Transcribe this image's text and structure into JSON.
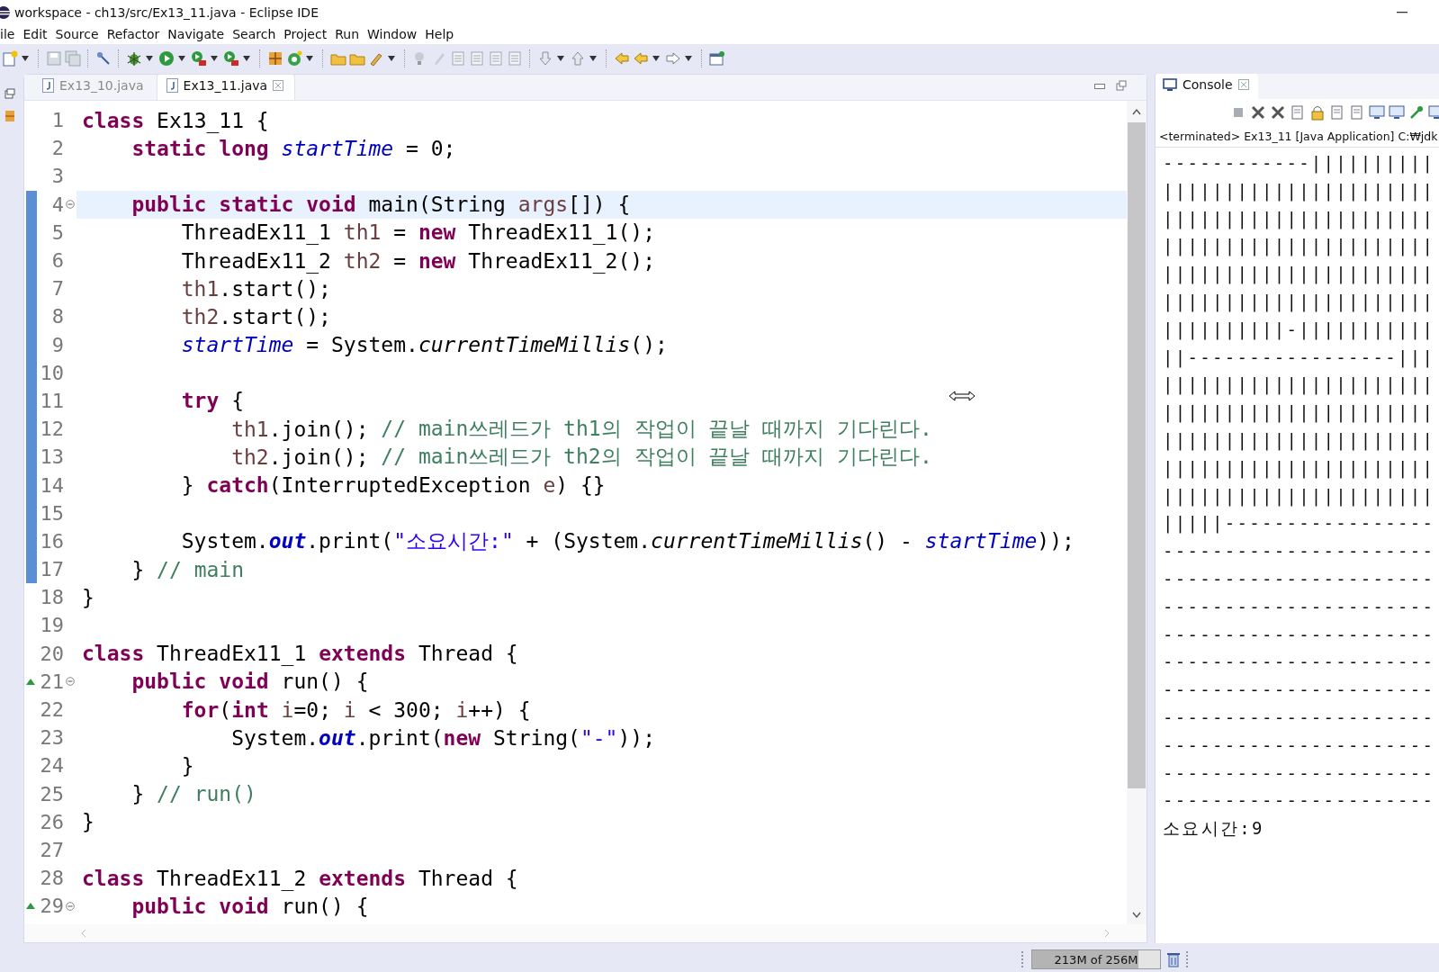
{
  "window": {
    "title": "workspace - ch13/src/Ex13_11.java - Eclipse IDE"
  },
  "menu": [
    "ile",
    "Edit",
    "Source",
    "Refactor",
    "Navigate",
    "Search",
    "Project",
    "Run",
    "Window",
    "Help"
  ],
  "editor": {
    "tabs": [
      {
        "label": "Ex13_10.java",
        "selected": false
      },
      {
        "label": "Ex13_11.java",
        "selected": true
      }
    ],
    "lines": [
      {
        "number": "1",
        "current": false,
        "in_range": false,
        "fold": false,
        "override": false,
        "tokens": [
          {
            "text": "class",
            "kind": "keyword"
          },
          {
            "text": " Ex13_11 {",
            "kind": "plain"
          }
        ]
      },
      {
        "number": "2",
        "current": false,
        "in_range": false,
        "fold": false,
        "override": false,
        "tokens": [
          {
            "text": "    static",
            "kind": "keyword"
          },
          {
            "text": " long",
            "kind": "keyword"
          },
          {
            "text": " startTime",
            "kind": "field"
          },
          {
            "text": " = 0;",
            "kind": "plain"
          }
        ]
      },
      {
        "number": "3",
        "current": false,
        "in_range": false,
        "fold": false,
        "override": false
      },
      {
        "number": "4",
        "current": true,
        "in_range": true,
        "fold": true,
        "override": false,
        "tokens": [
          {
            "text": "    public",
            "kind": "keyword"
          },
          {
            "text": " static",
            "kind": "keyword"
          },
          {
            "text": " void",
            "kind": "keyword"
          },
          {
            "text": " main(String ",
            "kind": "plain"
          },
          {
            "text": "args",
            "kind": "local"
          },
          {
            "text": "[]) {",
            "kind": "plain"
          }
        ]
      },
      {
        "number": "5",
        "current": false,
        "in_range": true,
        "fold": false,
        "override": false,
        "tokens": [
          {
            "text": "        ThreadEx11_1 ",
            "kind": "plain"
          },
          {
            "text": "th1",
            "kind": "local"
          },
          {
            "text": " = ",
            "kind": "plain"
          },
          {
            "text": "new",
            "kind": "keyword"
          },
          {
            "text": " ThreadEx11_1();",
            "kind": "plain"
          }
        ]
      },
      {
        "number": "6",
        "current": false,
        "in_range": true,
        "fold": false,
        "override": false,
        "tokens": [
          {
            "text": "        ThreadEx11_2 ",
            "kind": "plain"
          },
          {
            "text": "th2",
            "kind": "local"
          },
          {
            "text": " = ",
            "kind": "plain"
          },
          {
            "text": "new",
            "kind": "keyword"
          },
          {
            "text": " ThreadEx11_2();",
            "kind": "plain"
          }
        ]
      },
      {
        "number": "7",
        "current": false,
        "in_range": true,
        "fold": false,
        "override": false,
        "tokens": [
          {
            "text": "        th1",
            "kind": "local"
          },
          {
            "text": ".start();",
            "kind": "plain"
          }
        ]
      },
      {
        "number": "8",
        "current": false,
        "in_range": true,
        "fold": false,
        "override": false,
        "tokens": [
          {
            "text": "        th2",
            "kind": "local"
          },
          {
            "text": ".start();",
            "kind": "plain"
          }
        ]
      },
      {
        "number": "9",
        "current": false,
        "in_range": true,
        "fold": false,
        "override": false,
        "tokens": [
          {
            "text": "        startTime",
            "kind": "field"
          },
          {
            "text": " = System.",
            "kind": "plain"
          },
          {
            "text": "currentTimeMillis",
            "kind": "static-method"
          },
          {
            "text": "();",
            "kind": "plain"
          }
        ]
      },
      {
        "number": "10",
        "current": false,
        "in_range": true,
        "fold": false,
        "override": false
      },
      {
        "number": "11",
        "current": false,
        "in_range": true,
        "fold": false,
        "override": false,
        "tokens": [
          {
            "text": "        try",
            "kind": "keyword"
          },
          {
            "text": " {",
            "kind": "plain"
          }
        ]
      },
      {
        "number": "12",
        "current": false,
        "in_range": true,
        "fold": false,
        "override": false,
        "tokens": [
          {
            "text": "            th1",
            "kind": "local"
          },
          {
            "text": ".join(); ",
            "kind": "plain"
          },
          {
            "text": "// main쓰레드가 th1의 작업이 끝날 때까지 기다린다.",
            "kind": "comment"
          }
        ]
      },
      {
        "number": "13",
        "current": false,
        "in_range": true,
        "fold": false,
        "override": false,
        "tokens": [
          {
            "text": "            th2",
            "kind": "local"
          },
          {
            "text": ".join(); ",
            "kind": "plain"
          },
          {
            "text": "// main쓰레드가 th2의 작업이 끝날 때까지 기다린다.",
            "kind": "comment"
          }
        ]
      },
      {
        "number": "14",
        "current": false,
        "in_range": true,
        "fold": false,
        "override": false,
        "tokens": [
          {
            "text": "        } ",
            "kind": "plain"
          },
          {
            "text": "catch",
            "kind": "keyword"
          },
          {
            "text": "(InterruptedException ",
            "kind": "plain"
          },
          {
            "text": "e",
            "kind": "local"
          },
          {
            "text": ") {}",
            "kind": "plain"
          }
        ]
      },
      {
        "number": "15",
        "current": false,
        "in_range": true,
        "fold": false,
        "override": false
      },
      {
        "number": "16",
        "current": false,
        "in_range": true,
        "fold": false,
        "override": false,
        "tokens": [
          {
            "text": "        System.",
            "kind": "plain"
          },
          {
            "text": "out",
            "kind": "static-field"
          },
          {
            "text": ".print(",
            "kind": "plain"
          },
          {
            "text": "\"소요시간:\"",
            "kind": "string"
          },
          {
            "text": " + (System.",
            "kind": "plain"
          },
          {
            "text": "currentTimeMillis",
            "kind": "static-method"
          },
          {
            "text": "() - ",
            "kind": "plain"
          },
          {
            "text": "startTime",
            "kind": "field"
          },
          {
            "text": "));",
            "kind": "plain"
          }
        ]
      },
      {
        "number": "17",
        "current": false,
        "in_range": true,
        "fold": false,
        "override": false,
        "tokens": [
          {
            "text": "    } ",
            "kind": "plain"
          },
          {
            "text": "// main",
            "kind": "comment"
          }
        ]
      },
      {
        "number": "18",
        "current": false,
        "in_range": false,
        "fold": false,
        "override": false,
        "tokens": [
          {
            "text": "}",
            "kind": "plain"
          }
        ]
      },
      {
        "number": "19",
        "current": false,
        "in_range": false,
        "fold": false,
        "override": false
      },
      {
        "number": "20",
        "current": false,
        "in_range": false,
        "fold": false,
        "override": false,
        "tokens": [
          {
            "text": "class",
            "kind": "keyword"
          },
          {
            "text": " ThreadEx11_1 ",
            "kind": "plain"
          },
          {
            "text": "extends",
            "kind": "keyword"
          },
          {
            "text": " Thread {",
            "kind": "plain"
          }
        ]
      },
      {
        "number": "21",
        "current": false,
        "in_range": false,
        "fold": true,
        "override": true,
        "tokens": [
          {
            "text": "    public",
            "kind": "keyword"
          },
          {
            "text": " void",
            "kind": "keyword"
          },
          {
            "text": " run() {",
            "kind": "plain"
          }
        ]
      },
      {
        "number": "22",
        "current": false,
        "in_range": false,
        "fold": false,
        "override": false,
        "tokens": [
          {
            "text": "        for",
            "kind": "keyword"
          },
          {
            "text": "(",
            "kind": "plain"
          },
          {
            "text": "int",
            "kind": "keyword"
          },
          {
            "text": " i",
            "kind": "local"
          },
          {
            "text": "=0; ",
            "kind": "plain"
          },
          {
            "text": "i",
            "kind": "local"
          },
          {
            "text": " < 300; ",
            "kind": "plain"
          },
          {
            "text": "i",
            "kind": "local"
          },
          {
            "text": "++) {",
            "kind": "plain"
          }
        ]
      },
      {
        "number": "23",
        "current": false,
        "in_range": false,
        "fold": false,
        "override": false,
        "tokens": [
          {
            "text": "            System.",
            "kind": "plain"
          },
          {
            "text": "out",
            "kind": "static-field"
          },
          {
            "text": ".print(",
            "kind": "plain"
          },
          {
            "text": "new",
            "kind": "keyword"
          },
          {
            "text": " String(",
            "kind": "plain"
          },
          {
            "text": "\"-\"",
            "kind": "string"
          },
          {
            "text": "));",
            "kind": "plain"
          }
        ]
      },
      {
        "number": "24",
        "current": false,
        "in_range": false,
        "fold": false,
        "override": false,
        "tokens": [
          {
            "text": "        }",
            "kind": "plain"
          }
        ]
      },
      {
        "number": "25",
        "current": false,
        "in_range": false,
        "fold": false,
        "override": false,
        "tokens": [
          {
            "text": "    } ",
            "kind": "plain"
          },
          {
            "text": "// run()",
            "kind": "comment"
          }
        ]
      },
      {
        "number": "26",
        "current": false,
        "in_range": false,
        "fold": false,
        "override": false,
        "tokens": [
          {
            "text": "}",
            "kind": "plain"
          }
        ]
      },
      {
        "number": "27",
        "current": false,
        "in_range": false,
        "fold": false,
        "override": false
      },
      {
        "number": "28",
        "current": false,
        "in_range": false,
        "fold": false,
        "override": false,
        "tokens": [
          {
            "text": "class",
            "kind": "keyword"
          },
          {
            "text": " ThreadEx11_2 ",
            "kind": "plain"
          },
          {
            "text": "extends",
            "kind": "keyword"
          },
          {
            "text": " Thread {",
            "kind": "plain"
          }
        ]
      },
      {
        "number": "29",
        "current": false,
        "in_range": false,
        "fold": true,
        "override": true,
        "tokens": [
          {
            "text": "    public",
            "kind": "keyword"
          },
          {
            "text": " void",
            "kind": "keyword"
          },
          {
            "text": " run() {",
            "kind": "plain"
          }
        ]
      }
    ]
  },
  "console": {
    "title": "Console",
    "header": "<terminated> Ex13_11 [Java Application] C:₩jdk",
    "output": [
      "------------||||||||||",
      "||||||||||||||||||||||",
      "||||||||||||||||||||||",
      "||||||||||||||||||||||",
      "||||||||||||||||||||||",
      "||||||||||||||||||||||",
      "||||||||||-|||||||||||",
      "||-----------------|||",
      "||||||||||||||||||||||",
      "||||||||||||||||||||||",
      "||||||||||||||||||||||",
      "||||||||||||||||||||||",
      "||||||||||||||||||||||",
      "|||||-----------------",
      "----------------------",
      "----------------------",
      "----------------------",
      "----------------------",
      "----------------------",
      "----------------------",
      "----------------------",
      "----------------------",
      "----------------------",
      "----------------------",
      "소요시간:9"
    ]
  },
  "status_bar": {
    "heap": {
      "label": "213M of 256M",
      "level": 0.83
    }
  }
}
